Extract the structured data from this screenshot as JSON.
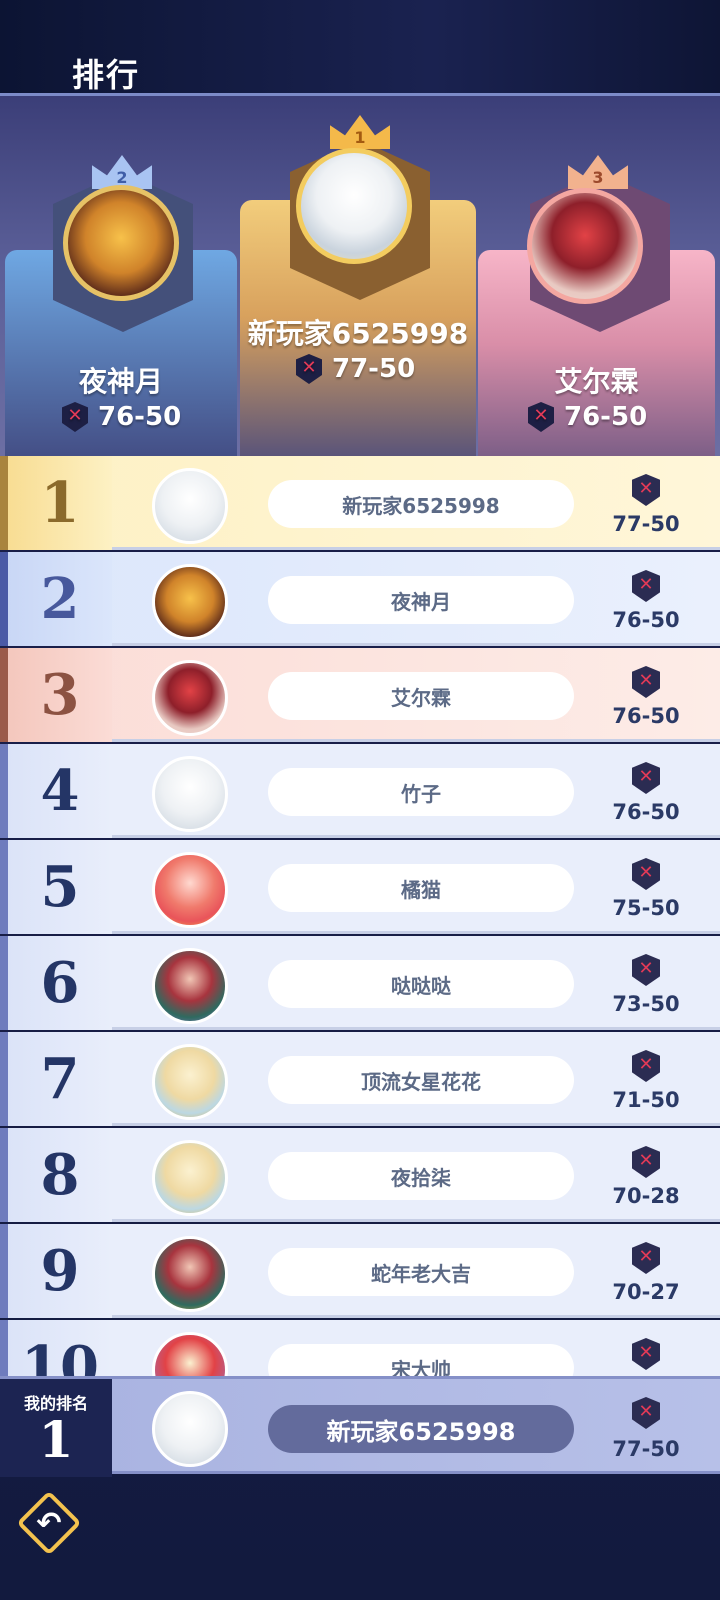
{
  "header": {
    "title": "排行"
  },
  "podium": [
    {
      "place": "2",
      "name": "夜神月",
      "score": "76-50"
    },
    {
      "place": "1",
      "name": "新玩家6525998",
      "score": "77-50"
    },
    {
      "place": "3",
      "name": "艾尔霖",
      "score": "76-50"
    }
  ],
  "rows": [
    {
      "rank": "1",
      "name": "新玩家6525998",
      "score": "77-50"
    },
    {
      "rank": "2",
      "name": "夜神月",
      "score": "76-50"
    },
    {
      "rank": "3",
      "name": "艾尔霖",
      "score": "76-50"
    },
    {
      "rank": "4",
      "name": "竹子",
      "score": "76-50"
    },
    {
      "rank": "5",
      "name": "橘猫",
      "score": "75-50"
    },
    {
      "rank": "6",
      "name": "哒哒哒",
      "score": "73-50"
    },
    {
      "rank": "7",
      "name": "顶流女星花花",
      "score": "71-50"
    },
    {
      "rank": "8",
      "name": "夜拾柒",
      "score": "70-28"
    },
    {
      "rank": "9",
      "name": "蛇年老大吉",
      "score": "70-27"
    },
    {
      "rank": "10",
      "name": "宋大帅",
      "score": ""
    }
  ],
  "my_rank": {
    "label": "我的排名",
    "rank": "1",
    "name": "新玩家6525998",
    "score": "77-50"
  },
  "icons": {
    "back": "back-arrow-icon",
    "score": "crossed-swords-shield-icon"
  }
}
